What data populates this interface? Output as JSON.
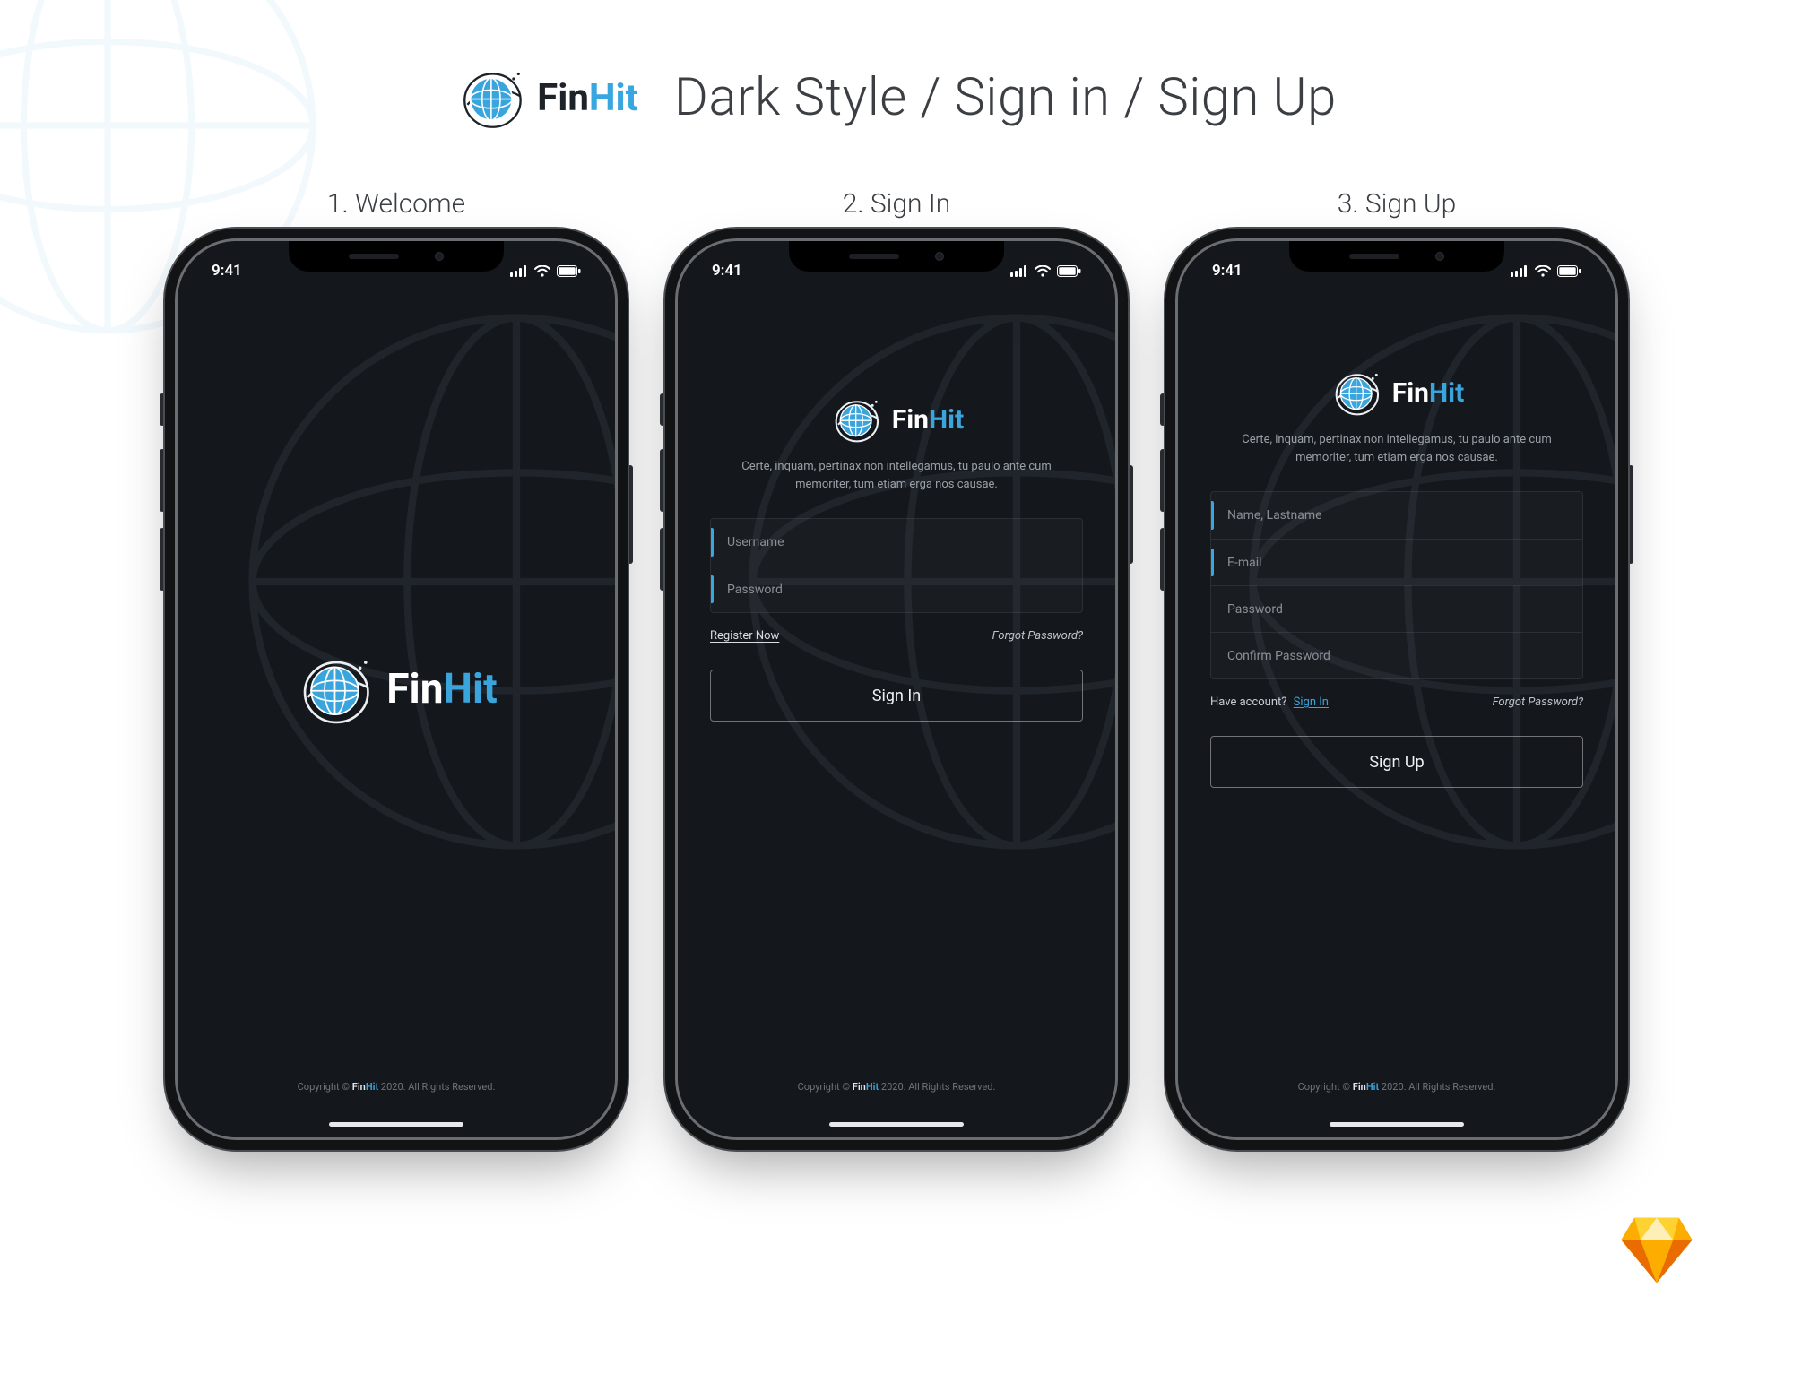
{
  "page": {
    "title": "Dark Style / Sign in / Sign Up"
  },
  "brand": {
    "fin": "Fin",
    "hit": "Hit",
    "accent_color": "#38a6df",
    "text_dark": "#1d2329",
    "text_light": "#ffffff"
  },
  "labels": {
    "welcome": "1. Welcome",
    "signin": "2. Sign In",
    "signup": "3. Sign Up"
  },
  "statusbar": {
    "time": "9:41"
  },
  "copy": {
    "tagline": "Certe, inquam, pertinax non intellegamus, tu paulo ante cum memoriter, tum etiam erga nos causae.",
    "copyright_prefix": "Copyright ",
    "copyright_suffix": " 2020. All Rights Reserved."
  },
  "screens": {
    "signin": {
      "fields": {
        "username": "Username",
        "password": "Password"
      },
      "links": {
        "register": "Register Now",
        "forgot": "Forgot Password?"
      },
      "button": "Sign In"
    },
    "signup": {
      "fields": {
        "name": "Name, Lastname",
        "email": "E-mail",
        "password": "Password",
        "confirm": "Confirm Password"
      },
      "links": {
        "have_account": "Have account?",
        "signin": "Sign In",
        "forgot": "Forgot Password?"
      },
      "button": "Sign Up"
    }
  }
}
